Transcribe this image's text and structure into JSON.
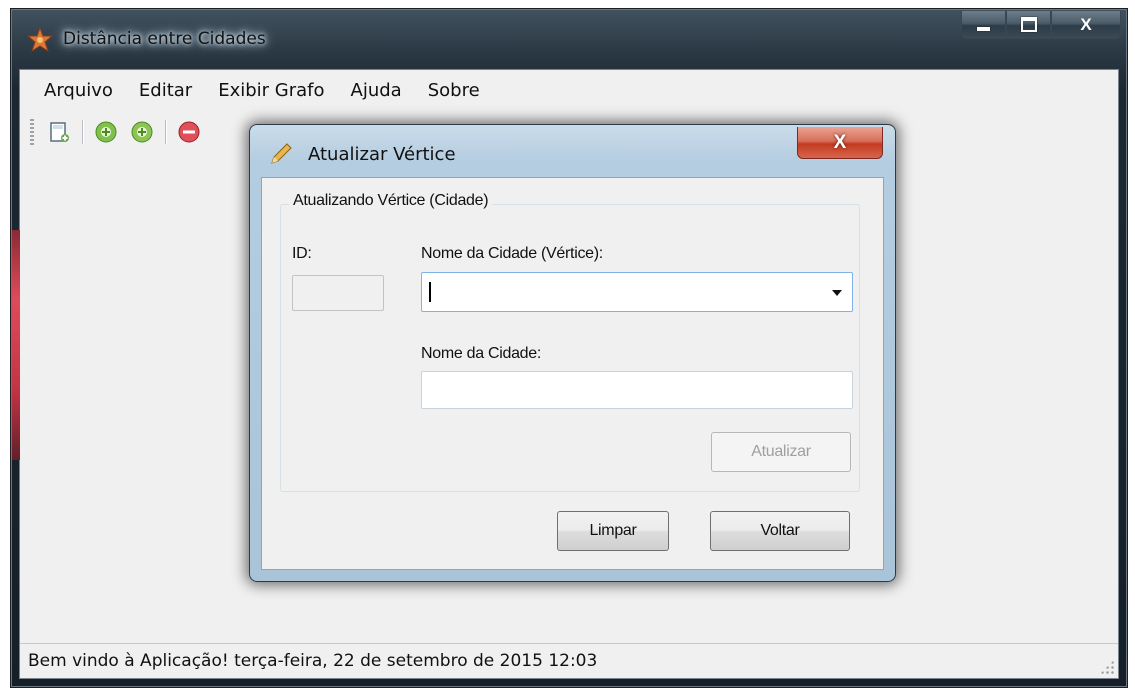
{
  "window": {
    "title": "Distância entre Cidades",
    "icon": "app-star-icon",
    "controls": {
      "minimize": "minimize-icon",
      "maximize": "maximize-icon",
      "close": "X"
    }
  },
  "menu": {
    "items": [
      {
        "label": "Arquivo"
      },
      {
        "label": "Editar"
      },
      {
        "label": "Exibir Grafo"
      },
      {
        "label": "Ajuda"
      },
      {
        "label": "Sobre"
      }
    ]
  },
  "toolbar": {
    "buttons": [
      {
        "icon": "new-document-icon"
      },
      {
        "icon": "add-green-icon"
      },
      {
        "icon": "add-green-alt-icon"
      },
      {
        "icon": "remove-red-icon"
      }
    ]
  },
  "dialog": {
    "title": "Atualizar Vértice",
    "icon": "pencil-icon",
    "close_label": "X",
    "group_title": "Atualizando Vértice (Cidade)",
    "id_label": "ID:",
    "id_value": "",
    "combo_label": "Nome da Cidade (Vértice):",
    "combo_value": "",
    "name_label": "Nome da Cidade:",
    "name_value": "",
    "update_button": "Atualizar",
    "clear_button": "Limpar",
    "back_button": "Voltar"
  },
  "status": {
    "text": "Bem vindo à Aplicação!  terça-feira, 22 de setembro de 2015  12:03"
  },
  "colors": {
    "accent_focus": "#7eb4ea",
    "close_red": "#c23b22"
  }
}
